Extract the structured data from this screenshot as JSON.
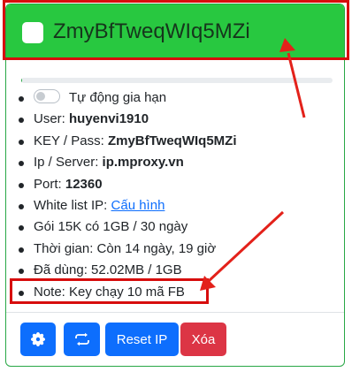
{
  "header": {
    "title": "ZmyBfTweqWIq5MZi"
  },
  "progress": {
    "value_percent": 0.3
  },
  "info": {
    "auto_renew_label": "Tự động gia hạn",
    "auto_renew_on": false,
    "user_label": "User: ",
    "user_value": "huyenvi1910",
    "key_label": "KEY / Pass: ",
    "key_value": "ZmyBfTweqWIq5MZi",
    "ip_label": "Ip / Server: ",
    "ip_value": "ip.mproxy.vn",
    "port_label": "Port: ",
    "port_value": "12360",
    "whitelist_label": "White list IP: ",
    "whitelist_link": "Cấu hình",
    "package": "Gói 15K có 1GB / 30 ngày",
    "time_remaining": "Thời gian: Còn 14 ngày, 19 giờ",
    "used": "Đã dùng: 52.02MB / 1GB",
    "note": "Note: Key chạy 10 mã FB"
  },
  "buttons": {
    "settings_icon": "gear-icon",
    "refresh_icon": "rotate-arrows-icon",
    "reset_ip_label": "Reset IP",
    "delete_label": "Xóa"
  },
  "colors": {
    "header": "#28c840",
    "primary": "#0d6efd",
    "danger": "#dc3545",
    "annotation": "#d70d0d"
  }
}
